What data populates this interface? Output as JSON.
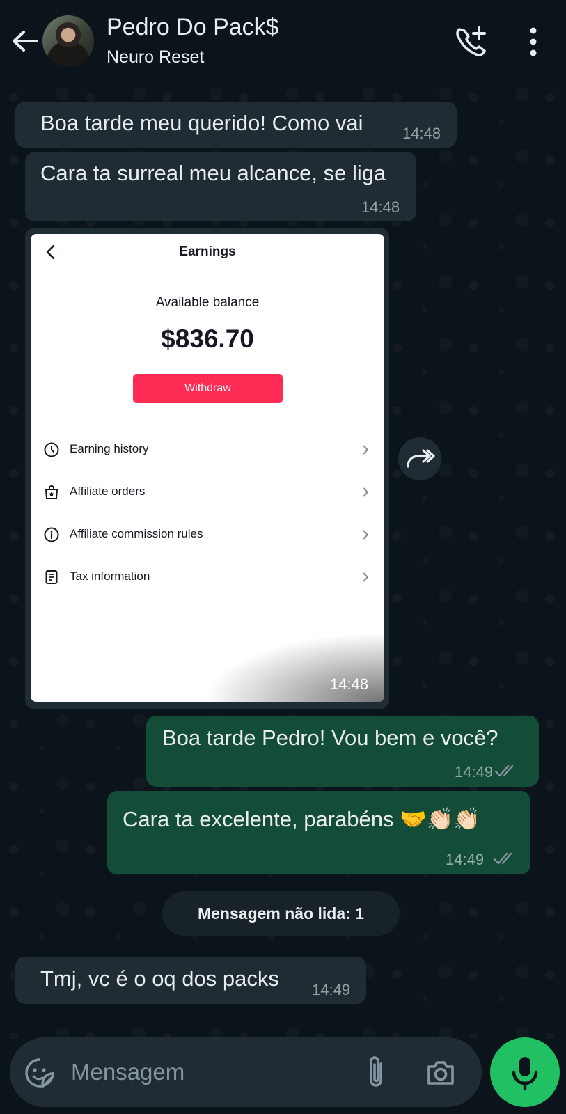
{
  "header": {
    "contact_name": "Pedro Do Pack$",
    "status": "Neuro Reset",
    "back_icon": "arrow-left-icon",
    "call_icon": "add-call-icon",
    "menu_icon": "more-vertical-icon"
  },
  "messages": [
    {
      "direction": "in",
      "text": "Boa tarde meu querido! Como vai",
      "time": "14:48"
    },
    {
      "direction": "in",
      "text": "Cara ta surreal meu alcance, se liga",
      "time": "14:48"
    },
    {
      "direction": "out",
      "text": "Boa tarde Pedro! Vou bem e você?",
      "time": "14:49",
      "status": "read"
    },
    {
      "direction": "out",
      "text": "Cara ta excelente, parabéns 🤝👏🏻👏🏻",
      "time": "14:49",
      "status": "read"
    },
    {
      "direction": "in",
      "text": "Tmj, vc é o oq dos packs",
      "time": "14:49"
    }
  ],
  "image_message": {
    "time": "14:48",
    "screen": {
      "title": "Earnings",
      "balance_label": "Available balance",
      "balance": "$836.70",
      "withdraw_label": "Withdraw",
      "rows": [
        {
          "label": "Earning history",
          "icon": "clock-icon"
        },
        {
          "label": "Affiliate orders",
          "icon": "shopping-bag-icon"
        },
        {
          "label": "Affiliate commission rules",
          "icon": "info-icon"
        },
        {
          "label": "Tax information",
          "icon": "document-icon"
        }
      ]
    }
  },
  "unread_banner": "Mensagem não lida: 1",
  "composer": {
    "placeholder": "Mensagem",
    "emoji_icon": "sticker-icon",
    "attach_icon": "paperclip-icon",
    "camera_icon": "camera-icon",
    "mic_icon": "microphone-icon"
  },
  "colors": {
    "background": "#0b141a",
    "incoming_bubble": "#202c33",
    "outgoing_bubble": "#144d37",
    "accent_green": "#21c063",
    "withdraw_button": "#fe2c55",
    "read_ticks": "#8696a0"
  }
}
